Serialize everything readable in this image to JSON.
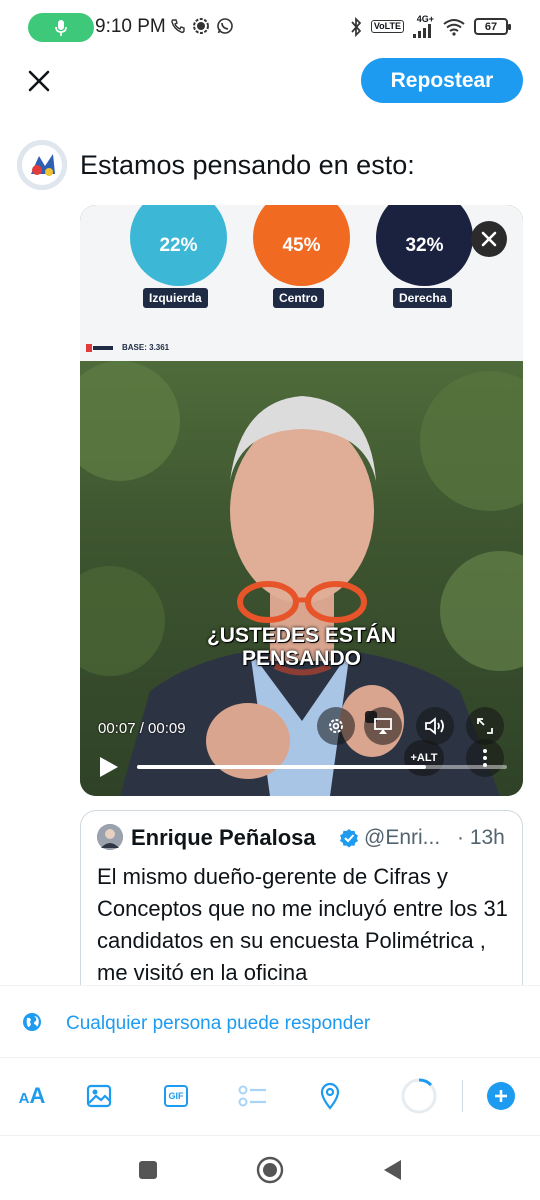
{
  "status_bar": {
    "time": "9:10 PM",
    "battery": "67",
    "network": "4G+",
    "lte": "VoLTE"
  },
  "header": {
    "repost_label": "Repostear"
  },
  "compose": {
    "text": "Estamos pensando en esto:"
  },
  "media": {
    "poll": [
      {
        "value": "22%",
        "label": "Izquierda",
        "color": "#3db7d6"
      },
      {
        "value": "45%",
        "label": "Centro",
        "color": "#f06a22"
      },
      {
        "value": "32%",
        "label": "Derecha",
        "color": "#1b2240"
      }
    ],
    "base_label": "BASE: 3.361",
    "caption_line1": "¿USTEDES ESTÁN",
    "caption_line2": "PENSANDO",
    "timecode": "00:07 / 00:09",
    "progress": 0.78,
    "alt_label": "+ALT"
  },
  "quote": {
    "name": "Enrique Peñalosa",
    "handle": "@Enri...",
    "time": "· 13h",
    "text": "El mismo dueño-gerente de Cifras y Conceptos que no me incluyó entre los 31 candidatos en su encuesta Polimétrica , me visitó en la oficina"
  },
  "reply_setting": {
    "label": "Cualquier persona puede responder"
  },
  "colors": {
    "accent": "#1d9bf0",
    "text": "#0f1419",
    "muted": "#536471"
  },
  "icons": {
    "close": "close-icon",
    "globe": "globe-icon",
    "text_format": "text-format-icon",
    "image": "image-icon",
    "gif": "gif-icon",
    "poll": "poll-icon",
    "location": "location-icon",
    "add": "add-icon"
  }
}
